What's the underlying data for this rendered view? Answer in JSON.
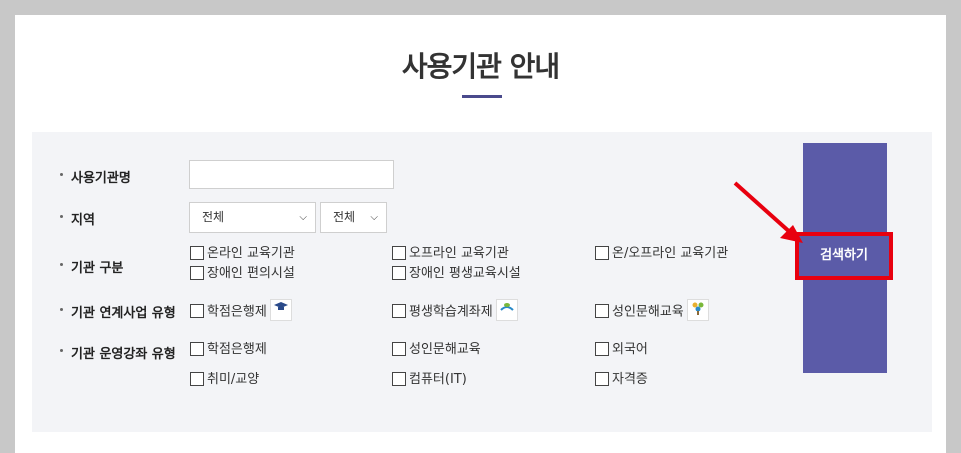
{
  "page": {
    "title": "사용기관 안내"
  },
  "form": {
    "labels": {
      "name": "사용기관명",
      "region": "지역",
      "type": "기관 구분",
      "program": "기관 연계사업 유형",
      "course": "기관 운영강좌 유형"
    },
    "name_value": "",
    "region_primary": "전체",
    "region_secondary": "전체",
    "type_options": [
      "온라인 교육기관",
      "오프라인 교육기관",
      "온/오프라인 교육기관",
      "장애인 편의시설",
      "장애인 평생교육시설"
    ],
    "program_options": [
      "학점은행제",
      "평생학습계좌제",
      "성인문해교육"
    ],
    "course_options": [
      "학점은행제",
      "성인문해교육",
      "외국어",
      "취미/교양",
      "컴퓨터(IT)",
      "자격증"
    ]
  },
  "search_button": {
    "label": "검색하기"
  },
  "colors": {
    "accent": "#5b5ba8",
    "highlight": "#e8000f",
    "background": "#f3f4f7"
  },
  "icons": {
    "program_badges": [
      "graduation-cap-icon",
      "book-leaf-icon",
      "tree-icon"
    ]
  }
}
